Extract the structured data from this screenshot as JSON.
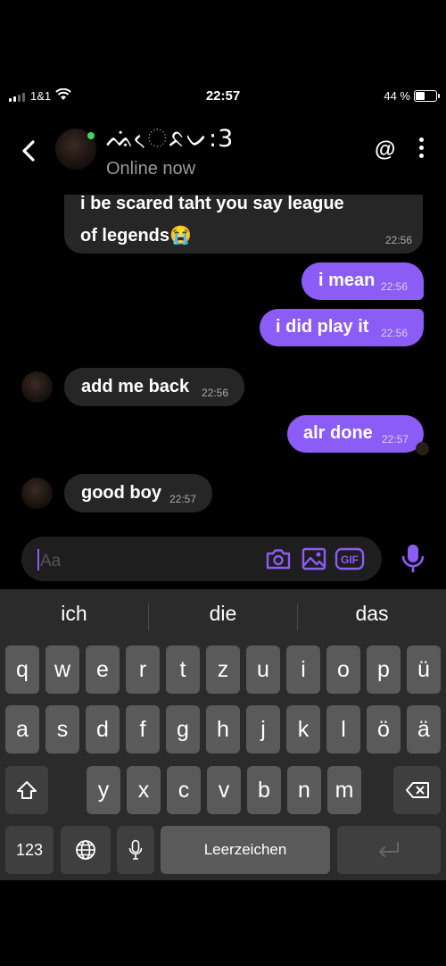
{
  "status_bar": {
    "carrier": "1&1",
    "time": "22:57",
    "battery": "44 %"
  },
  "header": {
    "name": "ᨕᨗᨙᨅᨆ:3",
    "status": "Online now",
    "at_label": "@"
  },
  "messages": [
    {
      "dir": "in",
      "text_line1": "i be scared taht you say league",
      "text_line2": "of legends😭",
      "time": "22:56"
    },
    {
      "dir": "out",
      "text": "i mean",
      "time": "22:56"
    },
    {
      "dir": "out",
      "text": "i did play it",
      "time": "22:56"
    },
    {
      "dir": "in",
      "text": "add me back",
      "time": "22:56"
    },
    {
      "dir": "out",
      "text": "alr done",
      "time": "22:57"
    },
    {
      "dir": "in",
      "text": "good boy",
      "time": "22:57"
    }
  ],
  "composer": {
    "placeholder": "Aa",
    "gif_label": "GIF"
  },
  "keyboard": {
    "suggestions": [
      "ich",
      "die",
      "das"
    ],
    "row1": [
      "q",
      "w",
      "e",
      "r",
      "t",
      "z",
      "u",
      "i",
      "o",
      "p",
      "ü"
    ],
    "row2": [
      "a",
      "s",
      "d",
      "f",
      "g",
      "h",
      "j",
      "k",
      "l",
      "ö",
      "ä"
    ],
    "row3": [
      "y",
      "x",
      "c",
      "v",
      "b",
      "n",
      "m"
    ],
    "numbers_label": "123",
    "space_label": "Leerzeichen"
  },
  "colors": {
    "accent": "#8b5cf6",
    "online": "#44d463"
  }
}
